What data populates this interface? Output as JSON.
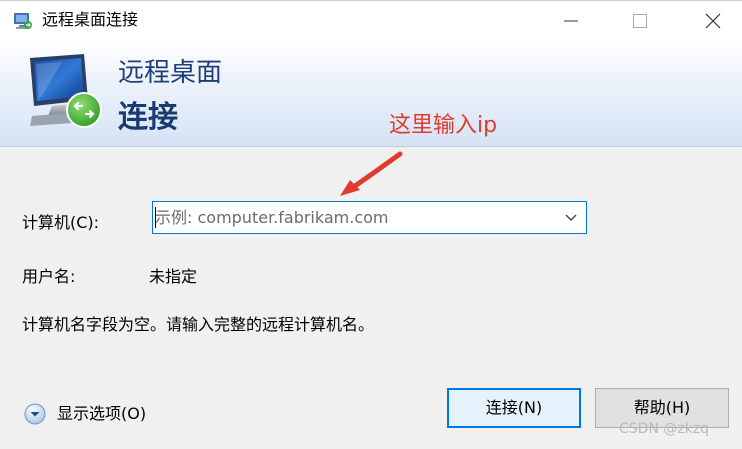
{
  "window": {
    "title": "远程桌面连接",
    "icon": "remote-desktop-icon"
  },
  "controls": {
    "minimize_icon": "minimize-icon",
    "maximize_icon": "maximize-icon",
    "close_icon": "close-icon"
  },
  "banner": {
    "line1": "远程桌面",
    "line2": "连接",
    "icon": "remote-desktop-monitor-icon"
  },
  "annotation": {
    "text": "这里输入ip",
    "color": "#e23b2e"
  },
  "form": {
    "computer_label": "计算机(C):",
    "computer_value": "",
    "computer_placeholder": "示例: computer.fabrikam.com",
    "user_label": "用户名:",
    "user_value": "未指定",
    "message": "计算机名字段为空。请输入完整的远程计算机名。"
  },
  "footer": {
    "options_label": "显示选项(O)",
    "connect_label": "连接(N)",
    "help_label": "帮助(H)",
    "watermark": "CSDN @zkzq"
  },
  "colors": {
    "accent": "#0078d7",
    "banner_text": "#1e3f7a"
  }
}
